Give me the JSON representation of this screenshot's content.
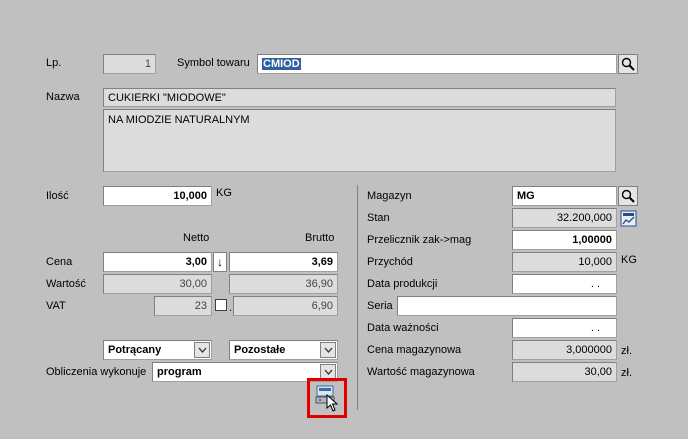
{
  "header": {
    "lp_label": "Lp.",
    "lp_value": "1",
    "symbol_label": "Symbol towaru",
    "symbol_value": "CMIOD"
  },
  "nazwa": {
    "label": "Nazwa",
    "value": "CUKIERKI \"MIODOWE\"",
    "description": "NA MIODZIE NATURALNYM"
  },
  "left": {
    "ilosc_label": "Ilość",
    "ilosc_value": "10,000",
    "ilosc_unit": "KG",
    "netto_header": "Netto",
    "brutto_header": "Brutto",
    "cena_label": "Cena",
    "cena_netto": "3,00",
    "cena_arrow": "↓",
    "cena_brutto": "3,69",
    "wartosc_label": "Wartość",
    "wartosc_netto": "30,00",
    "wartosc_brutto": "36,90",
    "vat_label": "VAT",
    "vat_rate": "23",
    "vat_value": "6,90",
    "vat_dot": ".",
    "potracany": "Potrącany",
    "pozostale": "Pozostałe",
    "obliczenia_label": "Obliczenia wykonuje",
    "obliczenia_value": "program"
  },
  "right": {
    "magazyn_label": "Magazyn",
    "magazyn_value": "MG",
    "stan_label": "Stan",
    "stan_value": "32.200,000",
    "przelicznik_label": "Przelicznik zak->mag",
    "przelicznik_value": "1,00000",
    "przychod_label": "Przychód",
    "przychod_value": "10,000",
    "przychod_unit": "KG",
    "data_produkcji_label": "Data produkcji",
    "data_produkcji_value": ". .",
    "seria_label": "Seria",
    "seria_value": "",
    "data_waznosci_label": "Data ważności",
    "data_waznosci_value": ". .",
    "cena_mag_label": "Cena magazynowa",
    "cena_mag_value": "3,000000",
    "cena_mag_unit": "zł.",
    "wartosc_mag_label": "Wartość magazynowa",
    "wartosc_mag_value": "30,00",
    "wartosc_mag_unit": "zł."
  },
  "icons": {
    "search": "search-icon",
    "calculator": "calculator-icon",
    "dropdown": "chevron-down-icon",
    "scanner": "scanner-icon",
    "cursor": "mouse-cursor-icon"
  },
  "colors": {
    "background": "#c0c0c0",
    "highlight_frame": "#e00000",
    "selection": "#3060a0"
  }
}
